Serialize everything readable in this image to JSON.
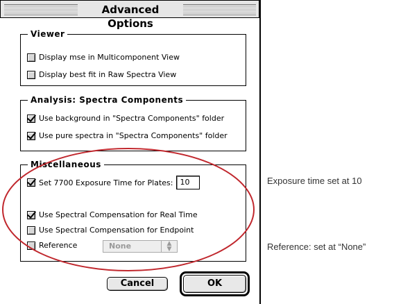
{
  "window": {
    "title": "Advanced Options"
  },
  "viewer": {
    "legend": "Viewer",
    "items": [
      {
        "label": "Display mse in Multicomponent View",
        "checked": false
      },
      {
        "label": "Display best fit in Raw Spectra View",
        "checked": false
      }
    ]
  },
  "analysis": {
    "legend": "Analysis: Spectra Components",
    "items": [
      {
        "label": "Use background in \"Spectra Components\" folder",
        "checked": true
      },
      {
        "label": "Use pure spectra in \"Spectra Components\" folder",
        "checked": true
      }
    ]
  },
  "misc": {
    "legend": "Miscellaneous",
    "exposure_label": "Set 7700 Exposure Time for Plates:",
    "exposure_checked": true,
    "exposure_value": "10",
    "realtime_label": "Use Spectral Compensation for Real Time",
    "realtime_checked": true,
    "endpoint_label": "Use Spectral Compensation for Endpoint",
    "endpoint_checked": false,
    "reference_label": "Reference",
    "reference_checked": false,
    "reference_value": "None"
  },
  "buttons": {
    "cancel": "Cancel",
    "ok": "OK"
  },
  "annotations": {
    "exposure": "Exposure time set at 10",
    "reference": "Reference: set at “None”"
  },
  "colors": {
    "highlight_ellipse": "#c0272d",
    "checked_mark": "#000000"
  }
}
